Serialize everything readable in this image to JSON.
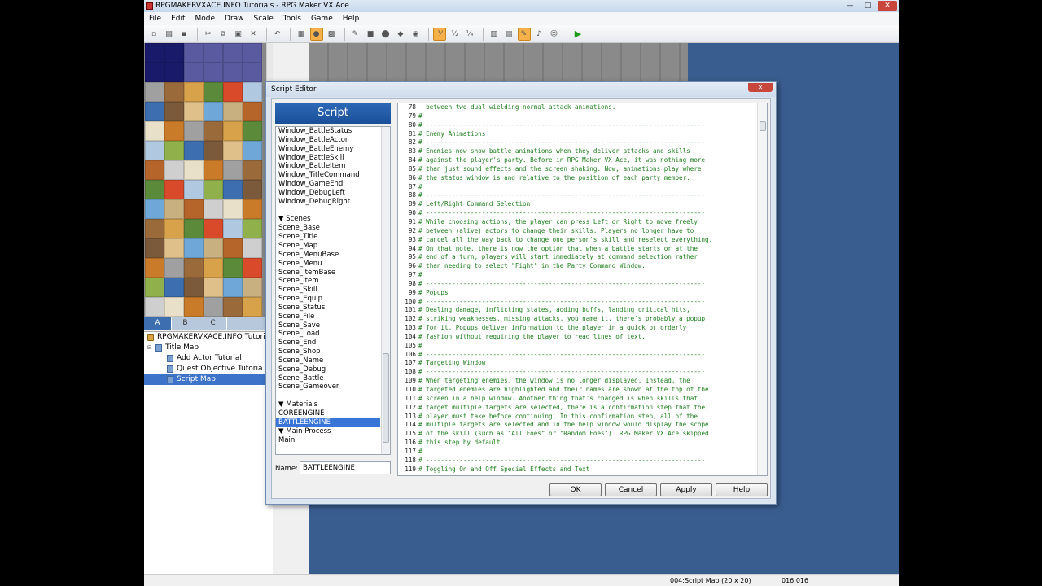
{
  "app": {
    "title": "RPGMAKERVXACE.INFO Tutorials - RPG Maker VX Ace",
    "menu": [
      "File",
      "Edit",
      "Mode",
      "Draw",
      "Scale",
      "Tools",
      "Game",
      "Help"
    ]
  },
  "tileset": {
    "tabs": [
      "A",
      "B",
      "C"
    ],
    "active_tab": "A"
  },
  "map_tree": [
    {
      "label": "RPGMAKERVXACE.INFO Tutori",
      "level": 0,
      "type": "project"
    },
    {
      "label": "Title Map",
      "level": 1,
      "type": "folder"
    },
    {
      "label": "Add Actor Tutorial",
      "level": 2,
      "type": "map"
    },
    {
      "label": "Quest Objective Tutoria",
      "level": 2,
      "type": "map"
    },
    {
      "label": "Script Map",
      "level": 2,
      "type": "map",
      "selected": true
    }
  ],
  "status": {
    "map": "004:Script Map (20 x 20)",
    "coords": "016,016"
  },
  "script_editor": {
    "title": "Script Editor",
    "close": "✕",
    "header": "Script",
    "list": [
      {
        "label": "Window_BattleStatus"
      },
      {
        "label": "Window_BattleActor"
      },
      {
        "label": "Window_BattleEnemy"
      },
      {
        "label": "Window_BattleSkill"
      },
      {
        "label": "Window_BattleItem"
      },
      {
        "label": "Window_TitleCommand"
      },
      {
        "label": "Window_GameEnd"
      },
      {
        "label": "Window_DebugLeft"
      },
      {
        "label": "Window_DebugRight"
      },
      {
        "label": "",
        "gap": true
      },
      {
        "label": "▼ Scenes",
        "group": true
      },
      {
        "label": "Scene_Base"
      },
      {
        "label": "Scene_Title"
      },
      {
        "label": "Scene_Map"
      },
      {
        "label": "Scene_MenuBase"
      },
      {
        "label": "Scene_Menu"
      },
      {
        "label": "Scene_ItemBase"
      },
      {
        "label": "Scene_Item"
      },
      {
        "label": "Scene_Skill"
      },
      {
        "label": "Scene_Equip"
      },
      {
        "label": "Scene_Status"
      },
      {
        "label": "Scene_File"
      },
      {
        "label": "Scene_Save"
      },
      {
        "label": "Scene_Load"
      },
      {
        "label": "Scene_End"
      },
      {
        "label": "Scene_Shop"
      },
      {
        "label": "Scene_Name"
      },
      {
        "label": "Scene_Debug"
      },
      {
        "label": "Scene_Battle"
      },
      {
        "label": "Scene_Gameover"
      },
      {
        "label": "",
        "gap": true
      },
      {
        "label": "▼ Materials",
        "group": true
      },
      {
        "label": "COREENGINE"
      },
      {
        "label": "BATTLEENGINE",
        "selected": true
      },
      {
        "label": "▼ Main Process",
        "group": true
      },
      {
        "label": "Main"
      }
    ],
    "name_label": "Name:",
    "name_value": "BATTLEENGINE",
    "code": [
      {
        "n": "78",
        "t": "  between two dual wielding normal attack animations."
      },
      {
        "n": "79",
        "t": "#"
      },
      {
        "n": "80",
        "t": "# ---------------------------------------------------------------------------"
      },
      {
        "n": "81",
        "t": "# Enemy Animations"
      },
      {
        "n": "82",
        "t": "# ---------------------------------------------------------------------------"
      },
      {
        "n": "83",
        "t": "# Enemies now show battle animations when they deliver attacks and skills"
      },
      {
        "n": "84",
        "t": "# against the player's party. Before in RPG Maker VX Ace, it was nothing more"
      },
      {
        "n": "85",
        "t": "# than just sound effects and the screen shaking. Now, animations play where"
      },
      {
        "n": "86",
        "t": "# the status window is and relative to the position of each party member."
      },
      {
        "n": "87",
        "t": "#"
      },
      {
        "n": "88",
        "t": "# ---------------------------------------------------------------------------"
      },
      {
        "n": "89",
        "t": "# Left/Right Command Selection"
      },
      {
        "n": "90",
        "t": "# ---------------------------------------------------------------------------"
      },
      {
        "n": "91",
        "t": "# While choosing actions, the player can press Left or Right to move freely"
      },
      {
        "n": "92",
        "t": "# between (alive) actors to change their skills. Players no longer have to"
      },
      {
        "n": "93",
        "t": "# cancel all the way back to change one person's skill and reselect everything."
      },
      {
        "n": "94",
        "t": "# On that note, there is now the option that when a battle starts or at the"
      },
      {
        "n": "95",
        "t": "# end of a turn, players will start immediately at command selection rather"
      },
      {
        "n": "96",
        "t": "# than needing to select \"Fight\" in the Party Command Window."
      },
      {
        "n": "97",
        "t": "#"
      },
      {
        "n": "98",
        "t": "# ---------------------------------------------------------------------------"
      },
      {
        "n": "99",
        "t": "# Popups"
      },
      {
        "n": "100",
        "t": "# ---------------------------------------------------------------------------"
      },
      {
        "n": "101",
        "t": "# Dealing damage, inflicting states, adding buffs, landing critical hits,"
      },
      {
        "n": "102",
        "t": "# striking weaknesses, missing attacks, you name it, there's probably a popup"
      },
      {
        "n": "103",
        "t": "# for it. Popups deliver information to the player in a quick or orderly"
      },
      {
        "n": "104",
        "t": "# fashion without requiring the player to read lines of text."
      },
      {
        "n": "105",
        "t": "#"
      },
      {
        "n": "106",
        "t": "# ---------------------------------------------------------------------------"
      },
      {
        "n": "107",
        "t": "# Targeting Window"
      },
      {
        "n": "108",
        "t": "# ---------------------------------------------------------------------------"
      },
      {
        "n": "109",
        "t": "# When targeting enemies, the window is no longer displayed. Instead, the"
      },
      {
        "n": "110",
        "t": "# targeted enemies are highlighted and their names are shown at the top of the"
      },
      {
        "n": "111",
        "t": "# screen in a help window. Another thing that's changed is when skills that"
      },
      {
        "n": "112",
        "t": "# target multiple targets are selected, there is a confirmation step that the"
      },
      {
        "n": "113",
        "t": "# player must take before continuing. In this confirmation step, all of the"
      },
      {
        "n": "114",
        "t": "# multiple targets are selected and in the help window would display the scope"
      },
      {
        "n": "115",
        "t": "# of the skill (such as \"All Foes\" or \"Random Foes\"). RPG Maker VX Ace skipped"
      },
      {
        "n": "116",
        "t": "# this step by default."
      },
      {
        "n": "117",
        "t": "#"
      },
      {
        "n": "118",
        "t": "# ---------------------------------------------------------------------------"
      },
      {
        "n": "119",
        "t": "# Toggling On and Off Special Effects and Text"
      }
    ],
    "buttons": {
      "ok": "OK",
      "cancel": "Cancel",
      "apply": "Apply",
      "help": "Help"
    }
  }
}
